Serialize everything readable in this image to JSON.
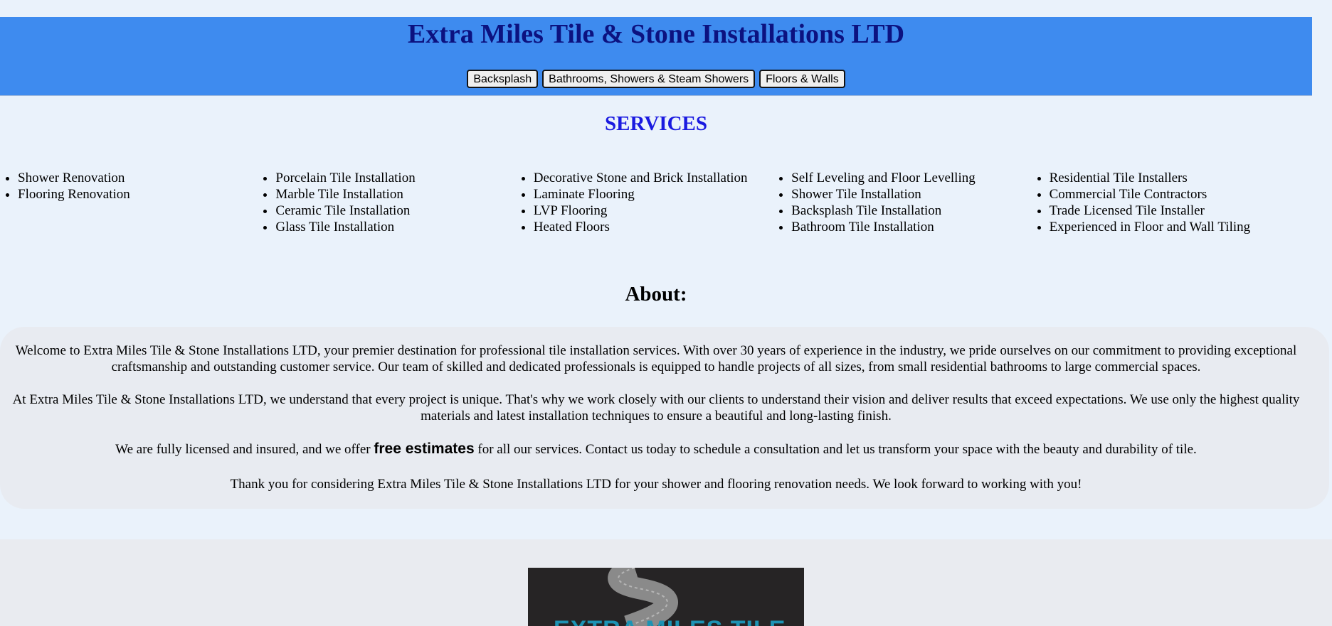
{
  "header": {
    "title": "Extra Miles Tile & Stone Installations LTD",
    "nav": [
      "Backsplash",
      "Bathrooms, Showers & Steam Showers",
      "Floors & Walls"
    ],
    "background_color": "#3e8bef",
    "title_color": "#0c1280"
  },
  "services": {
    "title": "SERVICES",
    "title_color": "#1a1ae0",
    "columns": [
      [
        "Shower Renovation",
        "Flooring Renovation"
      ],
      [
        "Porcelain Tile Installation",
        "Marble Tile Installation",
        "Ceramic Tile Installation",
        "Glass Tile Installation"
      ],
      [
        "Decorative Stone and Brick Installation",
        "Laminate Flooring",
        "LVP Flooring",
        "Heated Floors"
      ],
      [
        "Self Leveling and Floor Levelling",
        "Shower Tile Installation",
        "Backsplash Tile Installation",
        "Bathroom Tile Installation"
      ],
      [
        "Residential Tile Installers",
        "Commercial Tile Contractors",
        "Trade Licensed Tile Installer",
        "Experienced in Floor and Wall Tiling"
      ]
    ]
  },
  "about": {
    "title": "About:",
    "p1": "Welcome to Extra Miles Tile & Stone Installations LTD, your premier destination for professional tile installation services. With over 30 years of experience in the industry, we pride ourselves on our commitment to providing exceptional craftsmanship and outstanding customer service. Our team of skilled and dedicated professionals is equipped to handle projects of all sizes, from small residential bathrooms to large commercial spaces.",
    "p2": "At Extra Miles Tile & Stone Installations LTD, we understand that every project is unique. That's why we work closely with our clients to understand their vision and deliver results that exceed expectations. We use only the highest quality materials and latest installation techniques to ensure a beautiful and long-lasting finish.",
    "p3_before": "We are fully licensed and insured, and we offer ",
    "p3_bold": "free estimates",
    "p3_after": " for all our services. Contact us today to schedule a consultation and let us transform your space with the beauty and durability of tile.",
    "p4": "Thank you for considering Extra Miles Tile & Stone Installations LTD for your shower and flooring renovation needs. We look forward to working with you!"
  },
  "footer": {
    "logo_text": "EXTRA MILES TILE"
  }
}
